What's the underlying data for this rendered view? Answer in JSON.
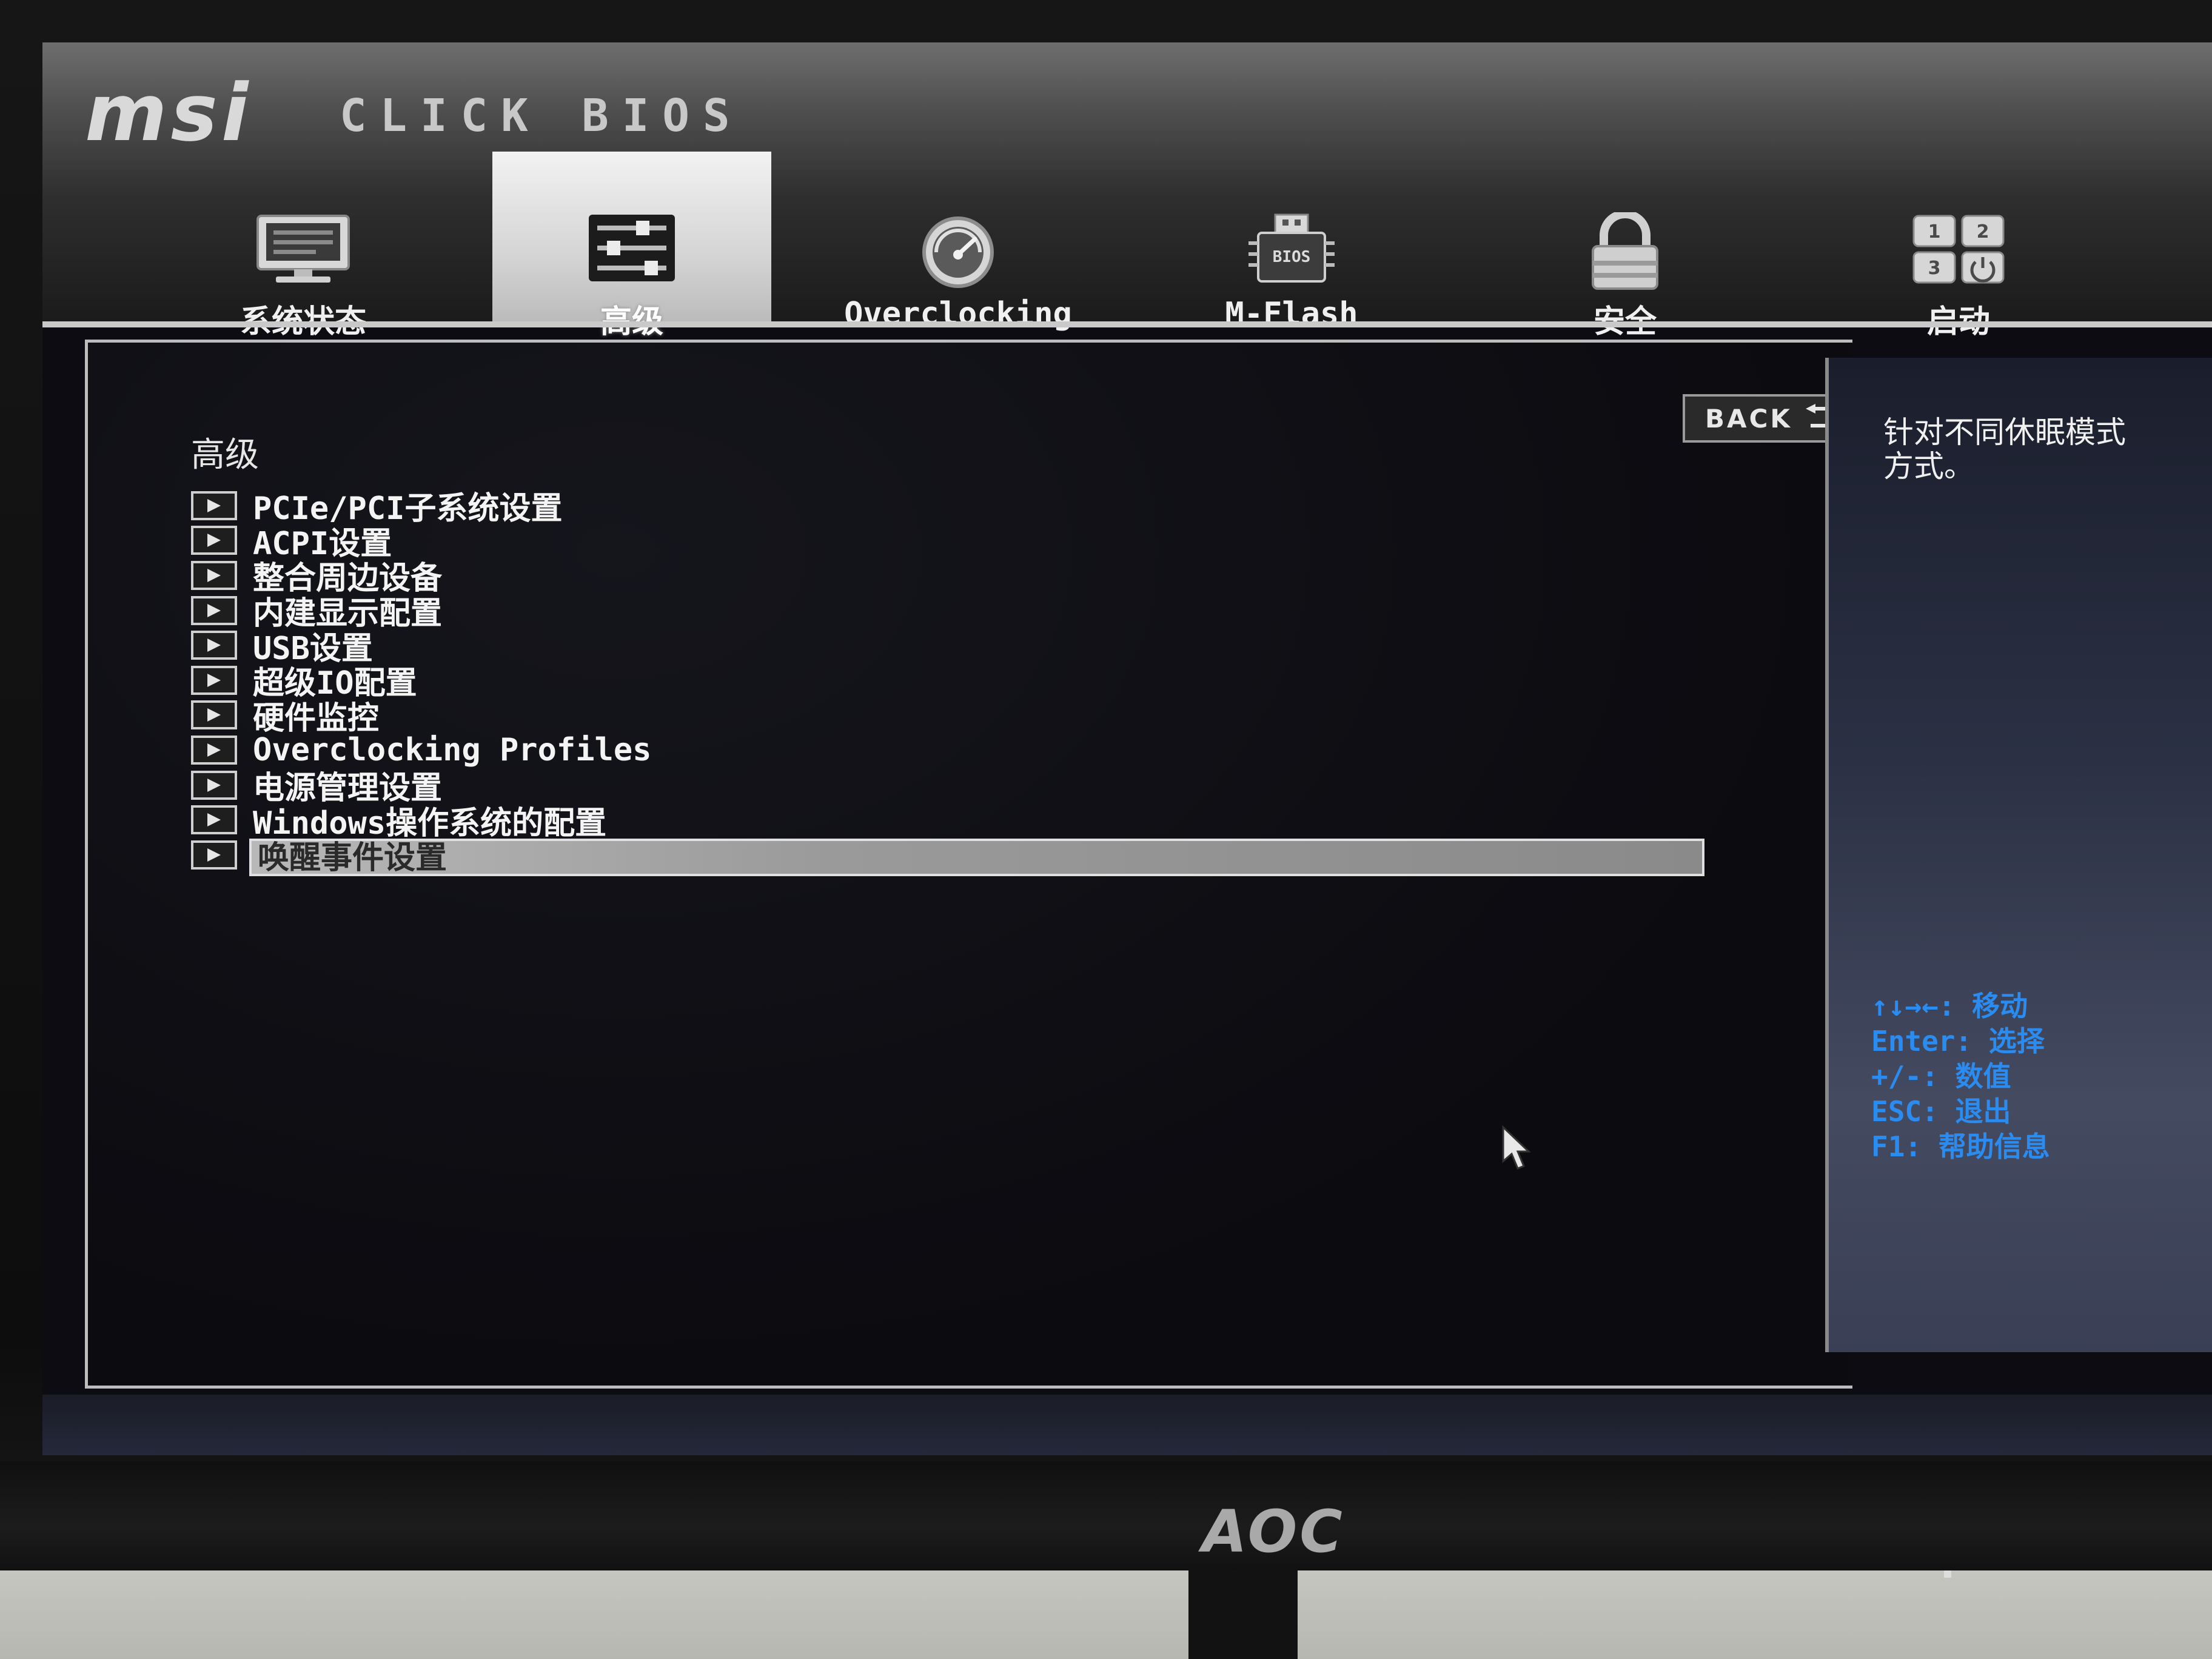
{
  "header": {
    "logo": "msi",
    "product": "CLICK BIOS"
  },
  "tabs": [
    {
      "label": "系统状态",
      "icon": "monitor-icon",
      "active": false
    },
    {
      "label": "高级",
      "icon": "settings-sliders-icon",
      "active": true
    },
    {
      "label": "Overclocking",
      "icon": "speedometer-icon",
      "active": false
    },
    {
      "label": "M-Flash",
      "icon": "bios-chip-icon",
      "active": false
    },
    {
      "label": "安全",
      "icon": "lock-icon",
      "active": false
    },
    {
      "label": "启动",
      "icon": "boot-order-icon",
      "active": false
    }
  ],
  "main": {
    "section_title": "高级",
    "back_label": "BACK",
    "menu_items": [
      "PCIe/PCI子系统设置",
      "ACPI设置",
      "整合周边设备",
      "内建显示配置",
      "USB设置",
      "超级IO配置",
      "硬件监控",
      "Overclocking Profiles",
      "电源管理设置",
      "Windows操作系统的配置",
      "唤醒事件设置"
    ],
    "selected_index": 10
  },
  "help": {
    "description": "针对不同休眠模式\n方式。",
    "key_hints": [
      "↑↓→←: 移动",
      "Enter: 选择",
      "+/-: 数值",
      "ESC: 退出",
      "F1: 帮助信息"
    ]
  },
  "monitor": {
    "brand": "AOC"
  },
  "colors": {
    "hint_blue": "#2a8cf0",
    "selection_gray": "#a0a0a0",
    "header_gray": "#4d4d4d"
  }
}
